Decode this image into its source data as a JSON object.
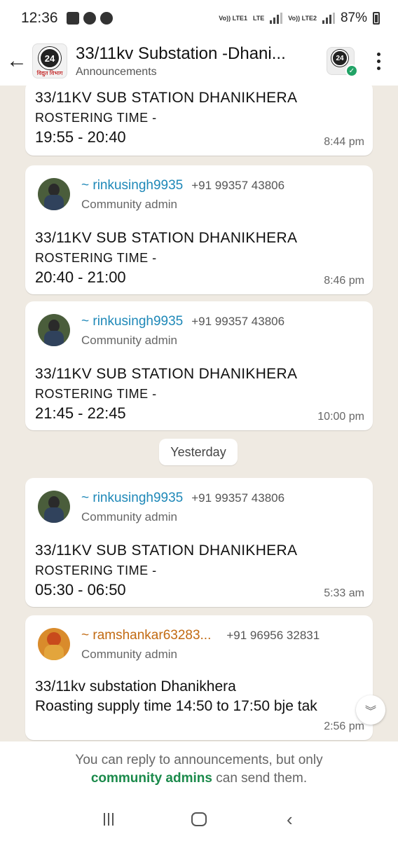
{
  "status_bar": {
    "time": "12:36",
    "net1": "Vo)) LTE1",
    "net2": "LTE",
    "net3": "Vo)) LTE2",
    "battery": "87%"
  },
  "header": {
    "logo_sub": "विद्युत विभाग",
    "logo_badge": "24",
    "title": "33/11kv Substation -Dhani...",
    "subtitle": "Announcements"
  },
  "messages": [
    {
      "line1": "33/11KV SUB STATION DHANIKHERA",
      "line2": "ROSTERING TIME -",
      "line3": "19:55 - 20:40",
      "time": "8:44 pm"
    },
    {
      "sender": "~ rinkusingh9935",
      "phone": "+91 99357 43806",
      "role": "Community admin",
      "line1": "33/11KV SUB STATION DHANIKHERA",
      "line2": "ROSTERING TIME -",
      "line3": "20:40 - 21:00",
      "time": "8:46 pm"
    },
    {
      "sender": "~ rinkusingh9935",
      "phone": "+91 99357 43806",
      "role": "Community admin",
      "line1": "33/11KV SUB STATION DHANIKHERA",
      "line2": "ROSTERING TIME -",
      "line3": "21:45 - 22:45",
      "time": "10:00 pm"
    },
    {
      "sender": "~ rinkusingh9935",
      "phone": "+91 99357 43806",
      "role": "Community admin",
      "line1": "33/11KV SUB STATION DHANIKHERA",
      "line2": "ROSTERING TIME -",
      "line3": "05:30 - 06:50",
      "time": "5:33 am"
    },
    {
      "sender": "~ ramshankar63283...",
      "phone": "+91 96956 32831",
      "role": "Community admin",
      "line1": "33/11kv substation Dhanikhera",
      "line2": "Roasting supply time 14:50 to 17:50 bje tak",
      "time": "2:56 pm"
    }
  ],
  "date_divider": "Yesterday",
  "footer": {
    "text_before": "You can reply to announcements, but only",
    "highlight": "community admins",
    "text_after": "can send them."
  },
  "colors": {
    "chat_bg": "#efeae2",
    "sender_blue": "#1e88b8",
    "sender_orange": "#c26a12",
    "highlight_green": "#1b8a4b"
  }
}
